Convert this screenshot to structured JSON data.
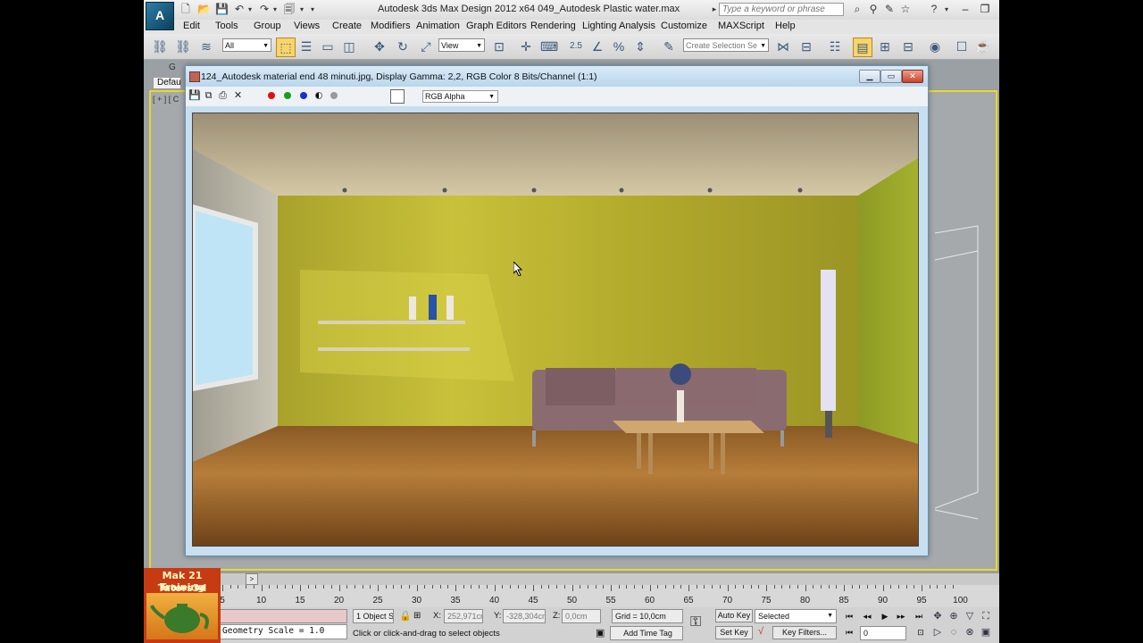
{
  "app": {
    "logo_text": "A",
    "title": "Autodesk 3ds Max Design 2012 x64      049_Autodesk Plastic water.max",
    "search_placeholder": "Type a keyword or phrase"
  },
  "menu": [
    "Edit",
    "Tools",
    "Group",
    "Views",
    "Create",
    "Modifiers",
    "Animation",
    "Graph Editors",
    "Rendering",
    "Lighting Analysis",
    "Customize",
    "MAXScript",
    "Help"
  ],
  "toolbar": {
    "filter_value": "All",
    "refcoord_value": "View",
    "named_selection_placeholder": "Create Selection Se"
  },
  "viewport": {
    "tab_label": "Defau",
    "tab_label_above": "G",
    "corner_label": "[ + ] [ C"
  },
  "frame_buffer": {
    "title": "124_Autodesk material end 48 minuti.jpg, Display Gamma: 2,2, RGB Color 8 Bits/Channel (1:1)",
    "channel_value": "RGB Alpha",
    "channel_colors": {
      "red": "#e01010",
      "green": "#16a016",
      "blue": "#1b2fd0"
    }
  },
  "timeline": {
    "frame_labels": [
      "5",
      "10",
      "15",
      "20",
      "25",
      "30",
      "35",
      "40",
      "45",
      "50",
      "55",
      "60",
      "65",
      "70",
      "75",
      "80",
      "85",
      "90",
      "95",
      "100"
    ],
    "slider_arrow": ">"
  },
  "status": {
    "maxscript_line": "Geometry Scale = 1.0",
    "selection_count": "1 Object Se",
    "x_label": "X:",
    "x_value": "252,971cm",
    "y_label": "Y:",
    "y_value": "-328,304cm",
    "z_label": "Z:",
    "z_value": "0,0cm",
    "grid": "Grid = 10,0cm",
    "prompt": "Click or click-and-drag to select objects",
    "add_time_tag": "Add Time Tag",
    "auto_key": "Auto Key",
    "set_key": "Set Key",
    "key_mode_value": "Selected",
    "key_filters": "Key Filters...",
    "current_frame": "0"
  },
  "watermark": {
    "line1": "Mak 21 Training",
    "line2": "Tutors3d .com"
  }
}
